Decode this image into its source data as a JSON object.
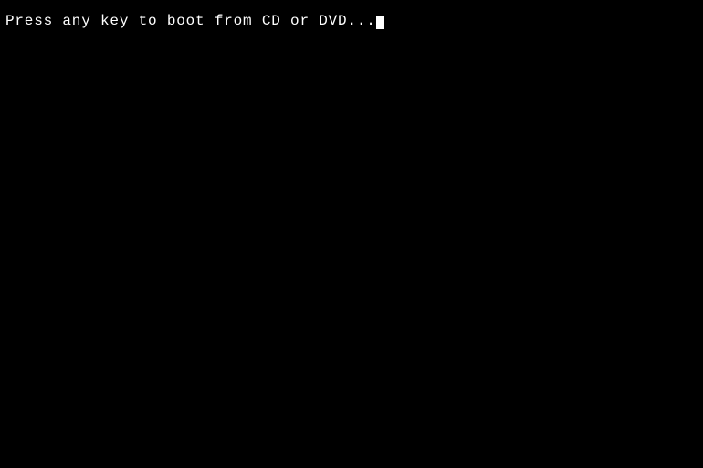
{
  "screen": {
    "background": "#000000",
    "boot_message": "Press any key to boot from CD or DVD...",
    "cursor_visible": true
  }
}
